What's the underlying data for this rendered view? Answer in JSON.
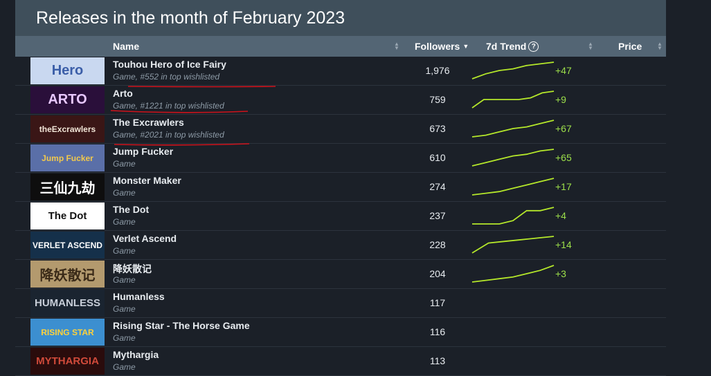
{
  "page": {
    "title": "Releases in the month of February 2023"
  },
  "table": {
    "columns": {
      "name": "Name",
      "followers": "Followers",
      "trend": "7d Trend",
      "price": "Price"
    },
    "rows": [
      {
        "name": "Touhou Hero of Ice Fairy",
        "sub": "Game, #552 in top wishlisted",
        "followers": "1,976",
        "trend": "+47",
        "spark": [
          0,
          3,
          5,
          6,
          8,
          9,
          10
        ],
        "thumb_text": "Hero",
        "thumb_bg": "#c9d8f0",
        "thumb_fg": "#3b5ea8"
      },
      {
        "name": "Arto",
        "sub": "Game, #1221 in top wishlisted",
        "followers": "759",
        "trend": "+9",
        "spark": [
          0,
          5,
          5,
          5,
          5,
          6,
          9,
          10
        ],
        "thumb_text": "ARTO",
        "thumb_bg": "#2a0f3a",
        "thumb_fg": "#e8c8ff"
      },
      {
        "name": "The Excrawlers",
        "sub": "Game, #2021 in top wishlisted",
        "followers": "673",
        "trend": "+67",
        "spark": [
          0,
          1,
          3,
          5,
          6,
          8,
          10
        ],
        "thumb_text": "theExcrawlers",
        "thumb_bg": "#3a1616",
        "thumb_fg": "#f2e6d8"
      },
      {
        "name": "Jump Fucker",
        "sub": "Game",
        "followers": "610",
        "trend": "+65",
        "spark": [
          0,
          2,
          4,
          6,
          7,
          9,
          10
        ],
        "thumb_text": "Jump Fucker",
        "thumb_bg": "#5a6fa8",
        "thumb_fg": "#f2c94c"
      },
      {
        "name": "Monster Maker",
        "sub": "Game",
        "followers": "274",
        "trend": "+17",
        "spark": [
          0,
          1,
          2,
          4,
          6,
          8,
          10
        ],
        "thumb_text": "三仙九劫",
        "thumb_bg": "#0e0e0e",
        "thumb_fg": "#ffffff"
      },
      {
        "name": "The Dot",
        "sub": "Game",
        "followers": "237",
        "trend": "+4",
        "spark": [
          0,
          0,
          0,
          2,
          8,
          8,
          10
        ],
        "thumb_text": "The Dot",
        "thumb_bg": "#ffffff",
        "thumb_fg": "#111111"
      },
      {
        "name": "Verlet Ascend",
        "sub": "Game",
        "followers": "228",
        "trend": "+14",
        "spark": [
          0,
          6,
          7,
          8,
          9,
          10
        ],
        "thumb_text": "VERLET ASCEND",
        "thumb_bg": "#15304a",
        "thumb_fg": "#ffffff"
      },
      {
        "name": "降妖散记",
        "sub": "Game",
        "followers": "204",
        "trend": "+3",
        "spark": [
          0,
          1,
          2,
          3,
          5,
          7,
          10
        ],
        "thumb_text": "降妖散记",
        "thumb_bg": "#b39a6e",
        "thumb_fg": "#3a2a18"
      },
      {
        "name": "Humanless",
        "sub": "Game",
        "followers": "117",
        "trend": "",
        "spark": [],
        "thumb_text": "HUMANLESS",
        "thumb_bg": "#1a2430",
        "thumb_fg": "#c7ced8"
      },
      {
        "name": "Rising Star - The Horse Game",
        "sub": "Game",
        "followers": "116",
        "trend": "",
        "spark": [],
        "thumb_text": "RISING STAR",
        "thumb_bg": "#3c8fd0",
        "thumb_fg": "#ffd23a"
      },
      {
        "name": "Mythargia",
        "sub": "Game",
        "followers": "113",
        "trend": "",
        "spark": [],
        "thumb_text": "MYTHARGIA",
        "thumb_bg": "#2a0c0c",
        "thumb_fg": "#d04a3a"
      }
    ]
  },
  "colors": {
    "trend_line": "#b5e82a",
    "trend_value": "#9de04a",
    "underline": "#d0121b"
  },
  "icons": {
    "sort": "sort-icon",
    "sort_desc": "caret-down-icon",
    "help": "help-circle-icon"
  }
}
